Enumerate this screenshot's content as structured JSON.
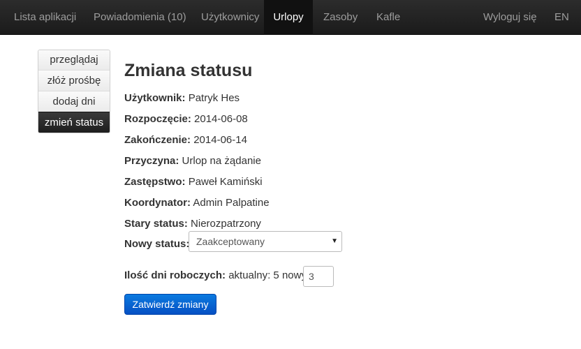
{
  "nav": {
    "items": [
      {
        "label": "Lista aplikacji"
      },
      {
        "label": "Powiadomienia (10)"
      },
      {
        "label": "Użytkownicy"
      },
      {
        "label": "Urlopy"
      },
      {
        "label": "Zasoby"
      },
      {
        "label": "Kafle"
      }
    ],
    "active": "Urlopy",
    "logout": "Wyloguj się",
    "lang": "EN"
  },
  "sidebar": {
    "items": [
      {
        "label": "przeglądaj"
      },
      {
        "label": "złóż prośbę"
      },
      {
        "label": "dodaj dni"
      },
      {
        "label": "zmień status"
      }
    ],
    "active": "zmień status"
  },
  "main": {
    "title": "Zmiana statusu",
    "fields": {
      "user": {
        "label": "Użytkownik:",
        "value": "Patryk Hes"
      },
      "start": {
        "label": "Rozpoczęcie:",
        "value": "2014-06-08"
      },
      "end": {
        "label": "Zakończenie:",
        "value": "2014-06-14"
      },
      "reason": {
        "label": "Przyczyna:",
        "value": "Urlop na żądanie"
      },
      "substitute": {
        "label": "Zastępstwo:",
        "value": "Paweł Kamiński"
      },
      "coordinator": {
        "label": "Koordynator:",
        "value": "Admin Palpatine"
      },
      "old_status": {
        "label": "Stary status:",
        "value": "Nierozpatrzony"
      }
    },
    "new_status": {
      "label": "Nowy status:",
      "selected": "Zaakceptowany"
    },
    "workdays": {
      "label": "Ilość dni roboczych:",
      "current_prefix": "aktualny:",
      "current_value": "5",
      "new_prefix": "nowy:",
      "new_value": "3"
    },
    "submit_label": "Zatwierdź zmiany"
  },
  "colors": {
    "navbar": "#222222",
    "nav_active": "#111111",
    "button": "#0a6fdb"
  },
  "icons": {
    "select_caret": "caret-down-icon"
  }
}
